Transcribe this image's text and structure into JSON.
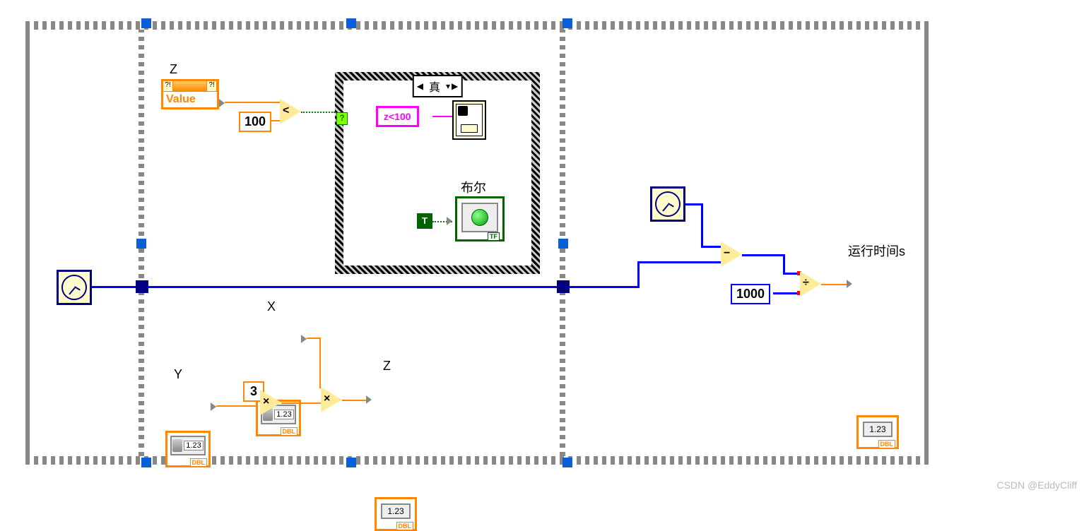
{
  "frames": {
    "z_local_var": {
      "label": "Z",
      "field": "Value"
    },
    "const_100": "100",
    "op_less": "<",
    "case_selector": "真",
    "string_z100": "z<100",
    "bool_label": "布尔",
    "bool_const": "T",
    "y_label": "Y",
    "y_val": "1.23",
    "x_label": "X",
    "x_val": "1.23",
    "const_3": "3",
    "op_mul1": "×",
    "op_mul2": "×",
    "z_out_label": "Z",
    "z_out_val": "1.23",
    "dbl_tag": "DBL",
    "tf_tag": "TF"
  },
  "frame3": {
    "const_1000": "1000",
    "op_sub": "−",
    "op_div": "÷",
    "runtime_label": "运行时间s",
    "runtime_val": "1.23",
    "dbl_tag": "DBL"
  },
  "indicator_sample": "1.23",
  "watermark": "CSDN @EddyCliff"
}
